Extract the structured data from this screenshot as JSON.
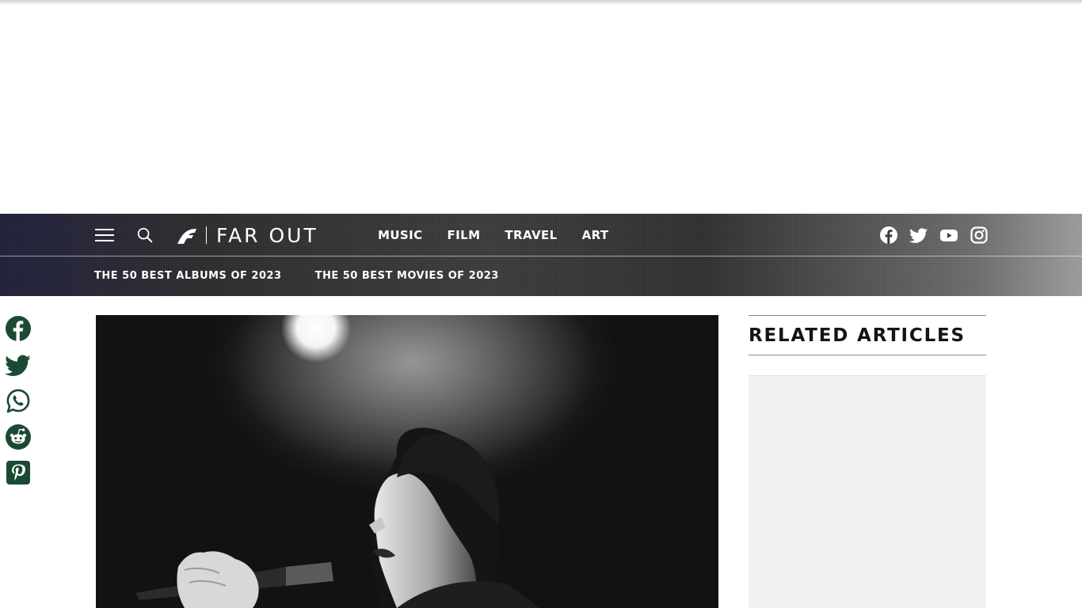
{
  "brand": {
    "name": "FAR OUT"
  },
  "nav": {
    "primary": [
      "MUSIC",
      "FILM",
      "TRAVEL",
      "ART"
    ],
    "secondary": [
      "THE 50 BEST ALBUMS OF 2023",
      "THE 50 BEST MOVIES OF 2023"
    ],
    "social_icons": [
      "facebook-icon",
      "twitter-icon",
      "youtube-icon",
      "instagram-icon"
    ]
  },
  "share": {
    "icons": [
      "facebook-icon",
      "twitter-icon",
      "whatsapp-icon",
      "reddit-icon",
      "pinterest-icon"
    ]
  },
  "sidebar": {
    "title": "RELATED ARTICLES"
  },
  "colors": {
    "share_icon": "#1b4a32",
    "nav_text": "#ffffff",
    "heading": "#141414"
  }
}
